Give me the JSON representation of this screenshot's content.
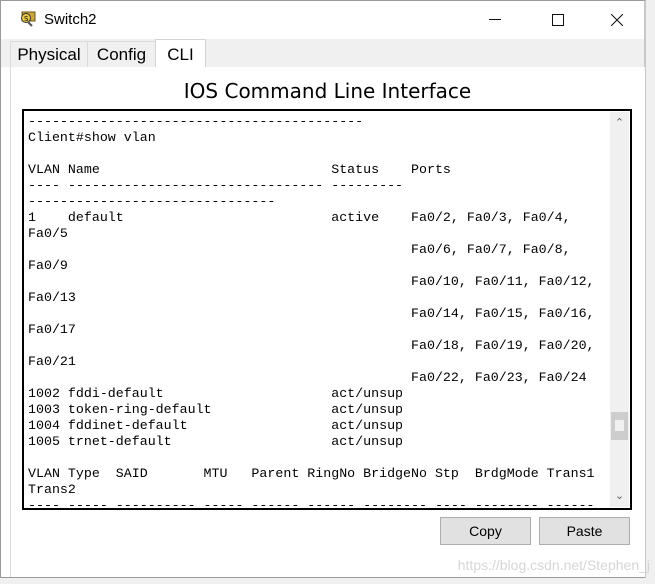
{
  "window": {
    "title": "Switch2",
    "icon": "switch-device-icon",
    "controls": [
      "minimize",
      "maximize",
      "close"
    ]
  },
  "tabs": [
    {
      "label": "Physical"
    },
    {
      "label": "Config"
    },
    {
      "label": "CLI",
      "active": true
    }
  ],
  "heading": "IOS Command Line Interface",
  "terminal": {
    "lines": [
      "------------------------------------------",
      "Client#show vlan",
      "",
      "VLAN Name                             Status    Ports",
      "---- -------------------------------- ---------",
      "-------------------------------",
      "1    default                          active    Fa0/2, Fa0/3, Fa0/4,",
      "Fa0/5",
      "                                                Fa0/6, Fa0/7, Fa0/8,",
      "Fa0/9",
      "                                                Fa0/10, Fa0/11, Fa0/12,",
      "Fa0/13",
      "                                                Fa0/14, Fa0/15, Fa0/16,",
      "Fa0/17",
      "                                                Fa0/18, Fa0/19, Fa0/20,",
      "Fa0/21",
      "                                                Fa0/22, Fa0/23, Fa0/24",
      "1002 fddi-default                     act/unsup",
      "1003 token-ring-default               act/unsup",
      "1004 fddinet-default                  act/unsup",
      "1005 trnet-default                    act/unsup",
      "",
      "VLAN Type  SAID       MTU   Parent RingNo BridgeNo Stp  BrdgMode Trans1",
      "Trans2",
      "---- ----- ---------- ----- ------ ------ -------- ---- -------- ------"
    ],
    "scroll_position": 0.8
  },
  "buttons": {
    "copy": "Copy",
    "paste": "Paste"
  },
  "watermark": "https://blog.csdn.net/Stephen_j"
}
